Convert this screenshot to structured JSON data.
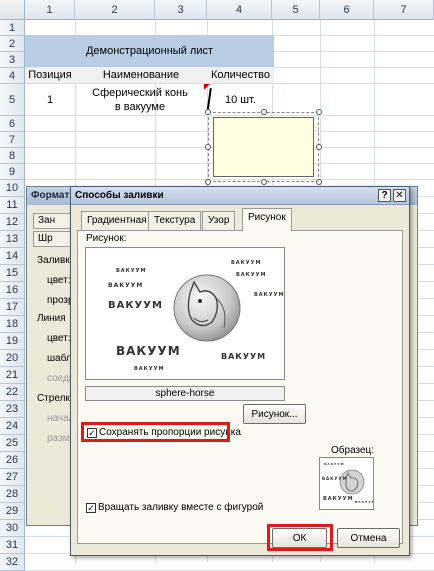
{
  "sheet": {
    "columns": [
      "1",
      "2",
      "3",
      "4",
      "5",
      "6",
      "7"
    ],
    "rows": [
      "1",
      "2",
      "3",
      "4",
      "5",
      "6",
      "7",
      "8",
      "9",
      "10",
      "11",
      "12",
      "13",
      "14",
      "15",
      "16",
      "17",
      "18",
      "19",
      "20",
      "21",
      "22",
      "23",
      "24",
      "25",
      "26",
      "27",
      "28",
      "29",
      "30",
      "31",
      "32"
    ],
    "title_cell": "Демонстрационный лист",
    "headers": [
      "Позиция",
      "Наименование",
      "Количество"
    ],
    "row5": {
      "position": "1",
      "name": "Сферический конь в вакууме",
      "quantity": "10 шт."
    }
  },
  "bg_dialog": {
    "title": "Формат ф",
    "tab_a": "Зан",
    "tab_b": "Шр",
    "labels": [
      "Заливка",
      "цвет:",
      "прозр",
      "Линия",
      "цвет:",
      "шабло",
      "соеди",
      "Стрелк",
      "начал",
      "разме"
    ]
  },
  "dialog": {
    "title": "Способы заливки",
    "help_btn": "?",
    "close_btn": "✕",
    "tabs": [
      "Градиентная",
      "Текстура",
      "Узор",
      "Рисунок"
    ],
    "active_tab": "Рисунок",
    "picture_label": "Рисунок:",
    "picture_name": "sphere-horse",
    "picture_button": "Рисунок...",
    "keep_ratio_label": "Сохранять пропорции рисунка",
    "keep_ratio_checked": true,
    "rotate_label": "Вращать заливку вместе с фигурой",
    "rotate_checked": true,
    "sample_label": "Образец:",
    "ok_label": "ОК",
    "cancel_label": "Отмена",
    "picture_text": [
      "ВАКУУМ",
      "ВАКУУМ",
      "ВАКУУМ",
      "ВАКУУМ",
      "ВАКУУМ",
      "ВАКУУМ",
      "ВАКУУМ",
      "ВАКУУМ",
      "ВАКУУМ"
    ]
  },
  "colors": {
    "highlight": "#e01818",
    "header_fill": "#b8cce4",
    "shape_fill": "#ffffe1"
  }
}
